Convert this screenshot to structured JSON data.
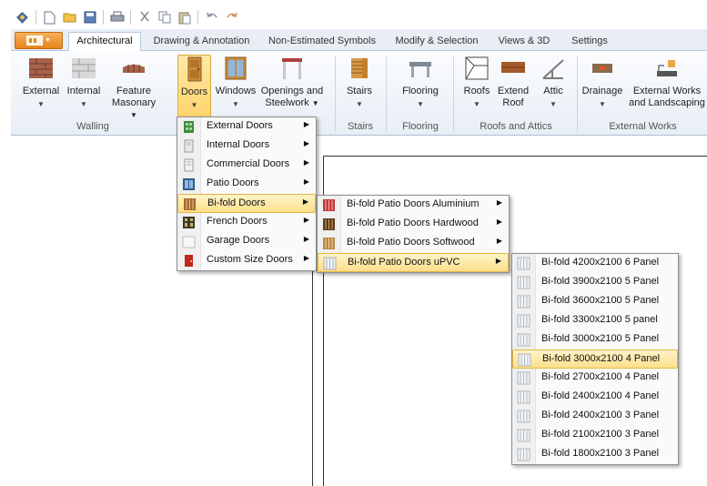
{
  "ribbon_tabs": [
    {
      "label": "Architectural",
      "active": true
    },
    {
      "label": "Drawing & Annotation",
      "active": false
    },
    {
      "label": "Non-Estimated Symbols",
      "active": false
    },
    {
      "label": "Modify & Selection",
      "active": false
    },
    {
      "label": "Views & 3D",
      "active": false
    },
    {
      "label": "Settings",
      "active": false
    }
  ],
  "quick_access": [
    "app-icon",
    "new-icon",
    "open-icon",
    "save-icon",
    "print-icon",
    "cut-icon",
    "copy-icon",
    "paste-icon",
    "undo-icon",
    "redo-icon"
  ],
  "ribbon": {
    "buttons": {
      "external": "External",
      "internal": "Internal",
      "feature_masonary_1": "Feature",
      "feature_masonary_2": "Masonary",
      "doors": "Doors",
      "windows": "Windows",
      "openings_1": "Openings and",
      "openings_2": "Steelwork",
      "stairs": "Stairs",
      "flooring": "Flooring",
      "roofs": "Roofs",
      "extend_roof_1": "Extend",
      "extend_roof_2": "Roof",
      "attic": "Attic",
      "drainage": "Drainage",
      "external_works_1": "External Works",
      "external_works_2": "and Landscaping"
    },
    "groups": {
      "walling": "Walling",
      "stairs": "Stairs",
      "flooring": "Flooring",
      "roofs_attics": "Roofs and Attics",
      "external_works": "External Works"
    }
  },
  "menus": {
    "doors": [
      {
        "label": "External Doors",
        "icon": "external-door-icon",
        "highlighted": false
      },
      {
        "label": "Internal Doors",
        "icon": "internal-door-icon",
        "highlighted": false
      },
      {
        "label": "Commercial Doors",
        "icon": "commercial-door-icon",
        "highlighted": false
      },
      {
        "label": "Patio Doors",
        "icon": "patio-door-icon",
        "highlighted": false
      },
      {
        "label": "Bi-fold Doors",
        "icon": "bifold-door-icon",
        "highlighted": true
      },
      {
        "label": "French Doors",
        "icon": "french-door-icon",
        "highlighted": false
      },
      {
        "label": "Garage Doors",
        "icon": "garage-door-icon",
        "highlighted": false
      },
      {
        "label": "Custom Size Doors",
        "icon": "custom-door-icon",
        "highlighted": false
      }
    ],
    "bifold": [
      {
        "label": "Bi-fold Patio Doors Aluminium",
        "highlighted": false
      },
      {
        "label": "Bi-fold Patio Doors Hardwood",
        "highlighted": false
      },
      {
        "label": "Bi-fold Patio Doors Softwood",
        "highlighted": false
      },
      {
        "label": "Bi-fold Patio Doors uPVC",
        "highlighted": true
      }
    ],
    "upvc": [
      {
        "label": "Bi-fold 4200x2100 6 Panel",
        "highlighted": false
      },
      {
        "label": "Bi-fold 3900x2100 5 Panel",
        "highlighted": false
      },
      {
        "label": "Bi-fold 3600x2100 5 Panel",
        "highlighted": false
      },
      {
        "label": "Bi-fold 3300x2100 5 panel",
        "highlighted": false
      },
      {
        "label": "Bi-fold 3000x2100 5 Panel",
        "highlighted": false
      },
      {
        "label": "Bi-fold 3000x2100 4 Panel",
        "highlighted": true
      },
      {
        "label": "Bi-fold 2700x2100 4 Panel",
        "highlighted": false
      },
      {
        "label": "Bi-fold 2400x2100 4 Panel",
        "highlighted": false
      },
      {
        "label": "Bi-fold 2400x2100 3 Panel",
        "highlighted": false
      },
      {
        "label": "Bi-fold 2100x2100 3 Panel",
        "highlighted": false
      },
      {
        "label": "Bi-fold 1800x2100 3 Panel",
        "highlighted": false
      }
    ]
  },
  "colors": {
    "accent": "#e7861f",
    "highlight": "#fbdf8a",
    "tab_bg": "#e9eef5"
  }
}
